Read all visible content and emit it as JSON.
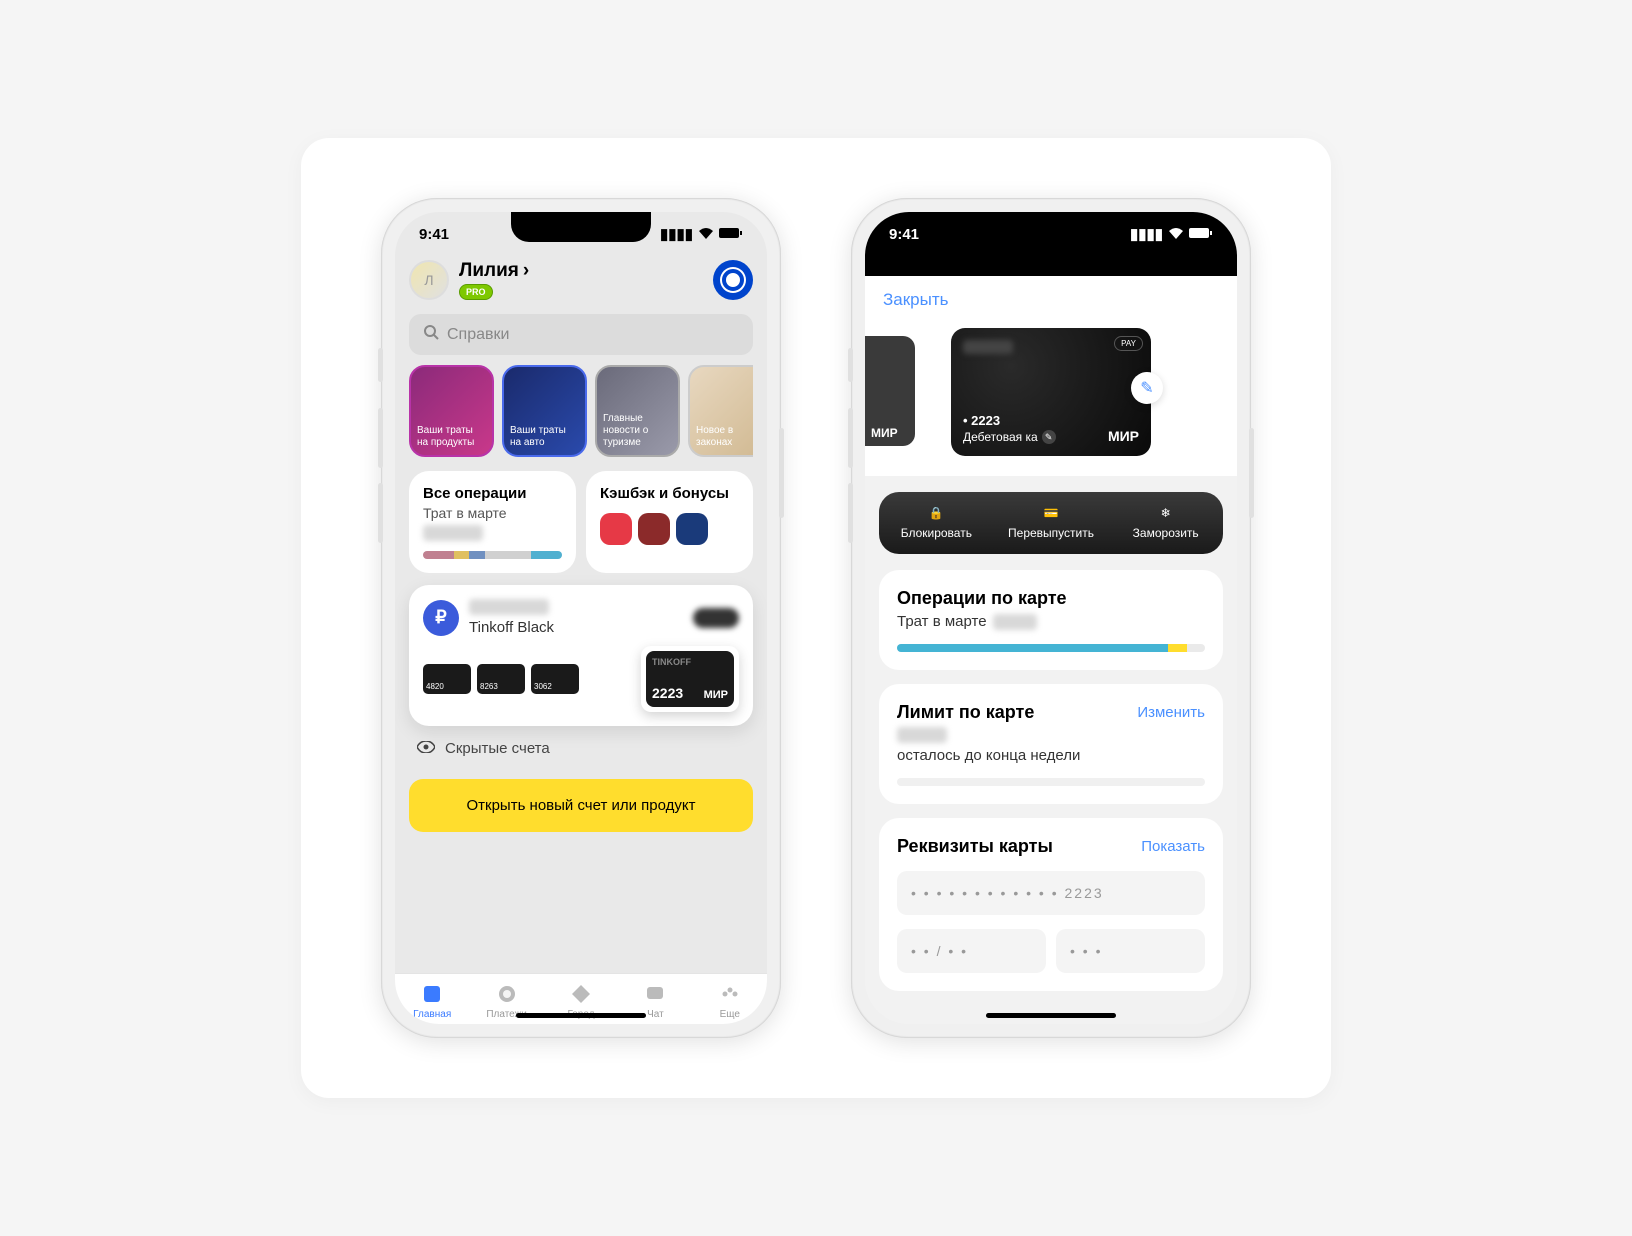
{
  "status": {
    "time": "9:41"
  },
  "home": {
    "avatar_initial": "Л",
    "user_name": "Лилия",
    "pro_label": "PRO",
    "search_placeholder": "Справки",
    "stories": [
      {
        "label": "Ваши траты на продукты"
      },
      {
        "label": "Ваши траты на авто"
      },
      {
        "label": "Главные новости о туризме"
      },
      {
        "label": "Новое в законах"
      }
    ],
    "ops_title": "Все операции",
    "ops_sub": "Трат в марте",
    "cashback_title": "Кэшбэк и бонусы",
    "account": {
      "name": "Tinkoff Black",
      "minis": [
        "4820",
        "8263",
        "3062"
      ],
      "big_last4": "2223",
      "scheme": "МИР"
    },
    "hidden_label": "Скрытые счета",
    "cta": "Открыть новый счет или продукт",
    "tabs": [
      "Главная",
      "Платежи",
      "Город",
      "Чат",
      "Еще"
    ]
  },
  "detail": {
    "close": "Закрыть",
    "card": {
      "brand": "TINKOFF",
      "pay_badge": "PAY",
      "last4": "• 2223",
      "type": "Дебетовая ка",
      "scheme": "МИР",
      "sliver": "МИР"
    },
    "actions": [
      "Блокировать",
      "Перевыпустить",
      "Заморозить"
    ],
    "ops_title": "Операции по карте",
    "ops_sub": "Трат в марте",
    "limit_title": "Лимит по карте",
    "limit_action": "Изменить",
    "limit_sub": "осталось до конца недели",
    "req_title": "Реквизиты карты",
    "req_action": "Показать",
    "req_pan": "• • • •   • • • •   • • • •   2223",
    "req_exp": "• •  /  • •",
    "req_cvv": "• • •"
  }
}
